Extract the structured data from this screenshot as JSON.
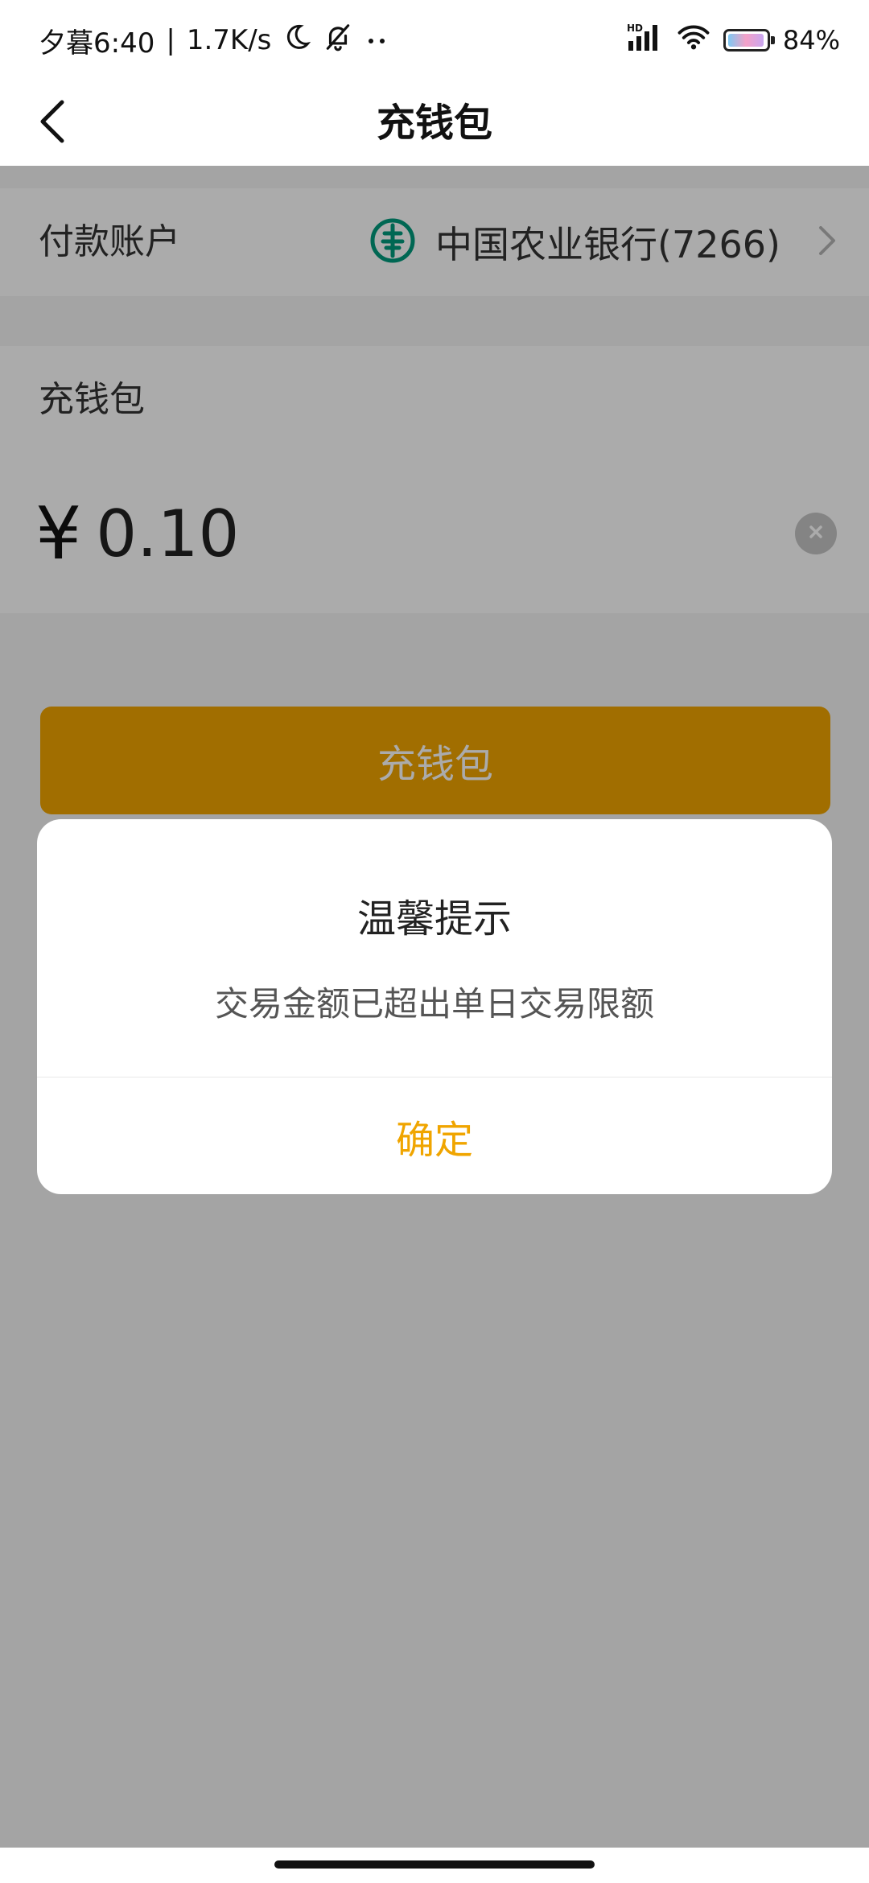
{
  "status_bar": {
    "time": "夕暮6:40",
    "separator": "|",
    "network_speed": "1.7K/s",
    "battery_percent": "84%",
    "network_label": "HD"
  },
  "nav": {
    "title": "充钱包"
  },
  "payment_account": {
    "label": "付款账户",
    "bank_name": "中国农业银行(7266)",
    "logo_color": "#009a7d"
  },
  "wallet_section": {
    "label": "充钱包",
    "currency_symbol": "¥",
    "amount": "0.10"
  },
  "primary_button": {
    "label": "充钱包",
    "color": "#f0a500"
  },
  "dialog": {
    "title": "温馨提示",
    "message": "交易金额已超出单日交易限额",
    "confirm_label": "确定",
    "accent_color": "#f0a500"
  }
}
